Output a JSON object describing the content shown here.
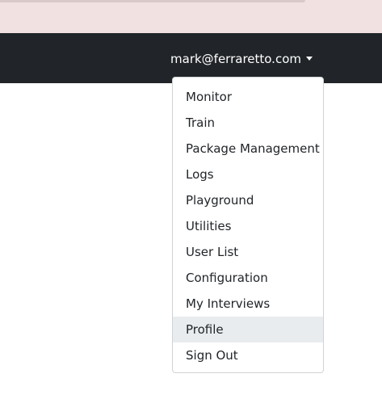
{
  "navbar": {
    "user_email": "mark@ferraretto.com"
  },
  "menu": {
    "items": [
      {
        "label": "Monitor"
      },
      {
        "label": "Train"
      },
      {
        "label": "Package Management"
      },
      {
        "label": "Logs"
      },
      {
        "label": "Playground"
      },
      {
        "label": "Utilities"
      },
      {
        "label": "User List"
      },
      {
        "label": "Configuration"
      },
      {
        "label": "My Interviews"
      },
      {
        "label": "Profile"
      },
      {
        "label": "Sign Out"
      }
    ],
    "highlighted": "Profile"
  },
  "colors": {
    "navbar_bg": "#212529",
    "top_strip_bg": "#f2e1e1",
    "hover_bg": "#e9ecef"
  }
}
